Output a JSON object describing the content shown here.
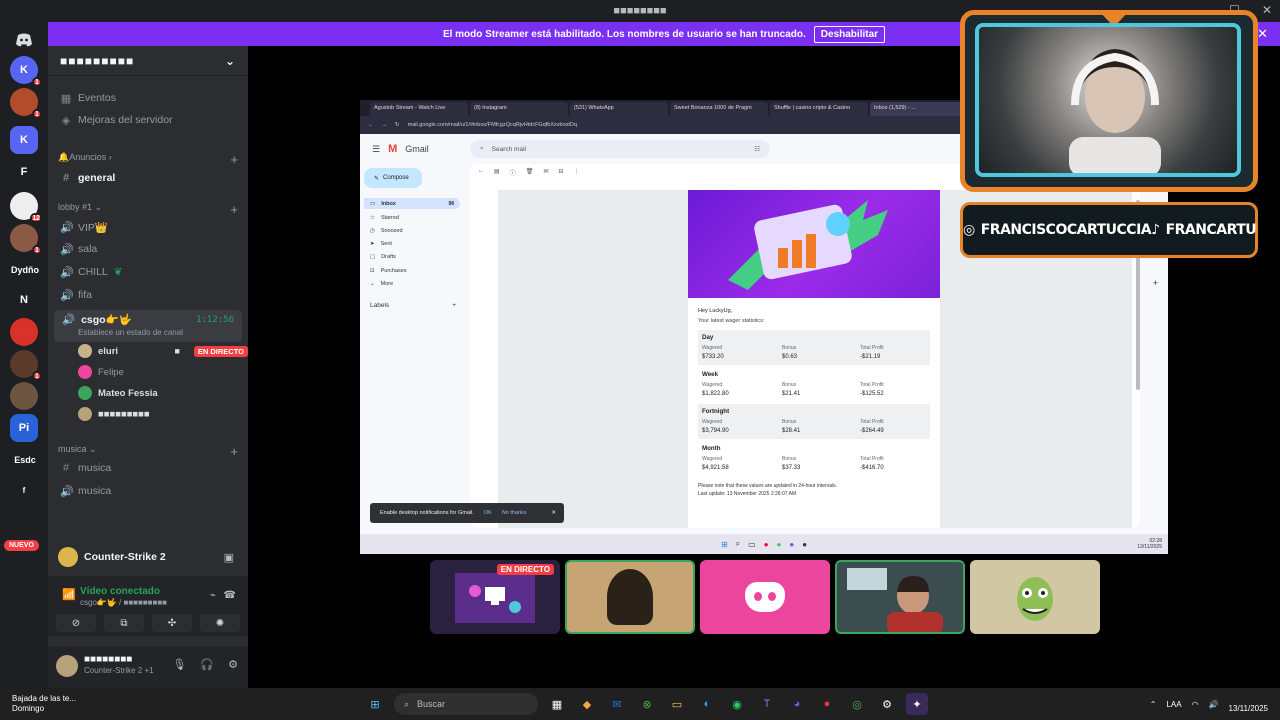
{
  "titlebar": {
    "title": "■■■■■■■■"
  },
  "banner": {
    "text": "El modo Streamer está habilitado. Los nombres de usuario se han truncado.",
    "button": "Deshabilitar"
  },
  "rail": {
    "servers": [
      {
        "label": "",
        "badge": "",
        "color": "#1e1f22"
      },
      {
        "label": "K",
        "badge": "1",
        "color": "#5865f2"
      },
      {
        "label": "",
        "badge": "1",
        "color": "#b14d2c"
      },
      {
        "label": "K",
        "badge": "",
        "color": "#5865f2"
      },
      {
        "label": "F",
        "badge": "",
        "color": "#1e1f22"
      },
      {
        "label": "",
        "badge": "12",
        "color": "#eeeeee"
      },
      {
        "label": "",
        "badge": "1",
        "color": "#8a5a44"
      },
      {
        "label": "Dydño",
        "badge": "",
        "color": "#1e1f22"
      },
      {
        "label": "N",
        "badge": "",
        "color": "#1e1f22"
      },
      {
        "label": "",
        "badge": "",
        "color": "#d8322b"
      },
      {
        "label": "",
        "badge": "1",
        "color": "#5a3a2a"
      },
      {
        "label": "",
        "badge": "",
        "color": "#6b5540"
      },
      {
        "label": "Pi",
        "badge": "",
        "color": "#2a63d8"
      },
      {
        "label": "Esdc",
        "badge": "",
        "color": "#1e1f22"
      },
      {
        "label": "f",
        "badge": "",
        "color": "#1e1f22"
      }
    ],
    "nuevo": "NUEVO"
  },
  "sidebar": {
    "server_name": "■■■■■■■■■",
    "events": "Eventos",
    "boosts": "Mejoras del servidor",
    "cat_announcements": "Anuncios",
    "general": "general",
    "cat_lobby": "lobby #1",
    "channels": [
      "VIP👑",
      "sala",
      "CHILL",
      "fifa"
    ],
    "csgo": {
      "name": "csgo👉🤟",
      "time": "1:12:56",
      "status": "Establece un estado de canal"
    },
    "voice_users": [
      {
        "name": "eluri",
        "live": "EN DIRECTO",
        "color": "#c9b18a"
      },
      {
        "name": "Felipe",
        "live": "",
        "color": "#eb459e"
      },
      {
        "name": "Mateo Fessia",
        "live": "",
        "color": "#3ba55c"
      },
      {
        "name": "■■■■■■■■■",
        "live": "",
        "color": "#b7a27a"
      }
    ],
    "cat_musica": "musica",
    "musica_text": "musica",
    "musica_voice": "musica"
  },
  "game": {
    "name": "Counter-Strike 2"
  },
  "voice": {
    "connected": "Vídeo conectado",
    "channel": "csgo👉🤟 / ■■■■■■■■■"
  },
  "user": {
    "name": "■■■■■■■■",
    "status": "Counter-Strike 2 +1"
  },
  "browser": {
    "tabs": [
      "Agustob Stream - Watch Live",
      "(8) Instagram",
      "(531) WhatsApp",
      "Sweet Bonanza 1000 de Pragm",
      "Shuffle | casino cripto & Casino",
      "Inbox (1,529) - ..."
    ],
    "url": "mail.google.com/mail/u/1/#inbox/FMfcgzQcqRjvHtdcFGqfbXxvboxtDq"
  },
  "gmail": {
    "logo": "Gmail",
    "search": "Search mail",
    "compose": "Compose",
    "nav": [
      {
        "label": "Inbox",
        "count": "98"
      },
      {
        "label": "Starred",
        "count": ""
      },
      {
        "label": "Snoozed",
        "count": ""
      },
      {
        "label": "Sent",
        "count": ""
      },
      {
        "label": "Drafts",
        "count": ""
      },
      {
        "label": "Purchases",
        "count": ""
      },
      {
        "label": "More",
        "count": ""
      }
    ],
    "labels": "Labels",
    "toast": {
      "text": "Enable desktop notifications for Gmail.",
      "ok": "OK",
      "no": "No thanks"
    }
  },
  "email": {
    "greeting": "Hey LuckyUg,",
    "subtitle": "Your latest wager statistics:",
    "col_wagered": "Wagered",
    "col_bonus": "Bonus",
    "col_profit": "Total Profit",
    "periods": [
      {
        "name": "Day",
        "wagered": "$733.20",
        "bonus": "$0.63",
        "profit": "-$21.19"
      },
      {
        "name": "Week",
        "wagered": "$1,822.80",
        "bonus": "$21.41",
        "profit": "-$125.52"
      },
      {
        "name": "Fortnight",
        "wagered": "$3,794.90",
        "bonus": "$28.41",
        "profit": "-$264.49"
      },
      {
        "name": "Month",
        "wagered": "$4,921.58",
        "bonus": "$37.33",
        "profit": "-$416.70"
      }
    ],
    "note": "Please note that these values are updated in 24-hour intervals.",
    "last_update": "Last update: 13 November 2025 2:26:07 AM"
  },
  "win_clock": {
    "time": "02:28",
    "date": "13/11/2025"
  },
  "socials": {
    "instagram": "FRANCISCOCARTUCCIA",
    "tiktok": "FRANCARTU"
  },
  "tiles": {
    "live": "EN DIRECTO"
  },
  "taskbar": {
    "weather_title": "Bajada de las te...",
    "weather_sub": "Domingo",
    "search": "Buscar",
    "lang": "LAA",
    "date": "13/11/2025"
  }
}
